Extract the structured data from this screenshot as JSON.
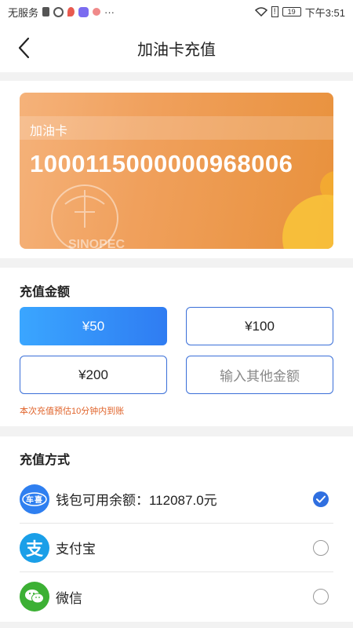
{
  "status_bar": {
    "carrier": "无服务",
    "battery": "19",
    "time": "下午3:51",
    "more": "···"
  },
  "header": {
    "title": "加油卡充值",
    "back_icon": "chevron-left-icon"
  },
  "card": {
    "label": "加油卡",
    "number": "1000115000000968006",
    "gradient_colors": [
      "#f5b27a",
      "#e8913c"
    ],
    "logo_icon": "sinopec-logo"
  },
  "amount": {
    "title": "充值金额",
    "options": [
      {
        "label": "¥50",
        "selected": true
      },
      {
        "label": "¥100",
        "selected": false
      },
      {
        "label": "¥200",
        "selected": false
      }
    ],
    "custom_placeholder": "输入其他金额",
    "note": "本次充值预估10分钟内到账",
    "accent": "#2f7cf2"
  },
  "payment": {
    "title": "充值方式",
    "methods": [
      {
        "label": "钱包可用余额：112087.0元",
        "icon": "wallet-app-icon",
        "checked": true
      },
      {
        "label": "支付宝",
        "icon": "alipay-icon",
        "checked": false
      },
      {
        "label": "微信",
        "icon": "wechat-icon",
        "checked": false
      }
    ]
  }
}
